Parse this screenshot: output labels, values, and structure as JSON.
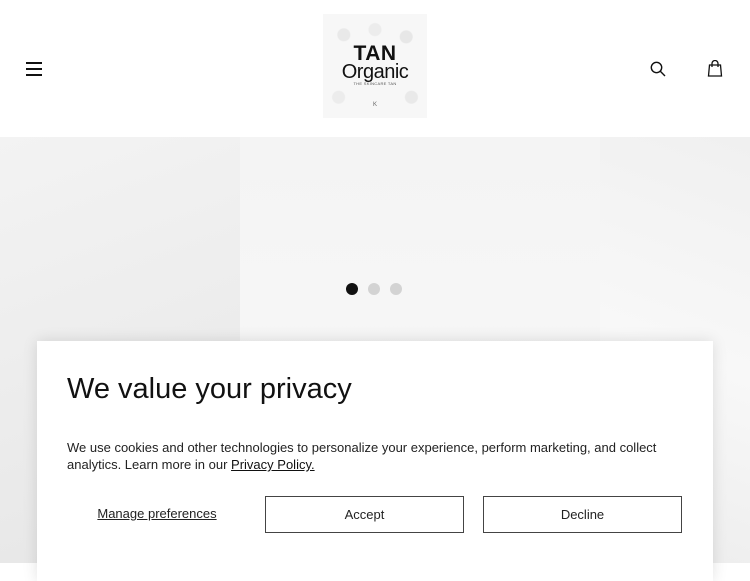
{
  "header": {
    "menu_icon": "hamburger-menu-icon",
    "logo": {
      "line1": "TAN",
      "line2": "Organic",
      "tagline": "THE SKINCARE TAN",
      "badge": "K"
    },
    "search_icon": "search-icon",
    "bag_icon": "shopping-bag-icon"
  },
  "carousel": {
    "slide_count": 3,
    "active_index": 0,
    "colors": {
      "active": "#111111",
      "inactive": "#d3d3d3"
    }
  },
  "consent": {
    "title": "We value your privacy",
    "body": "We use cookies and other technologies to personalize your experience, perform marketing, and collect analytics. Learn more in our",
    "link": "Privacy Policy.",
    "manage_label": "Manage preferences",
    "accept_label": "Accept",
    "decline_label": "Decline"
  }
}
